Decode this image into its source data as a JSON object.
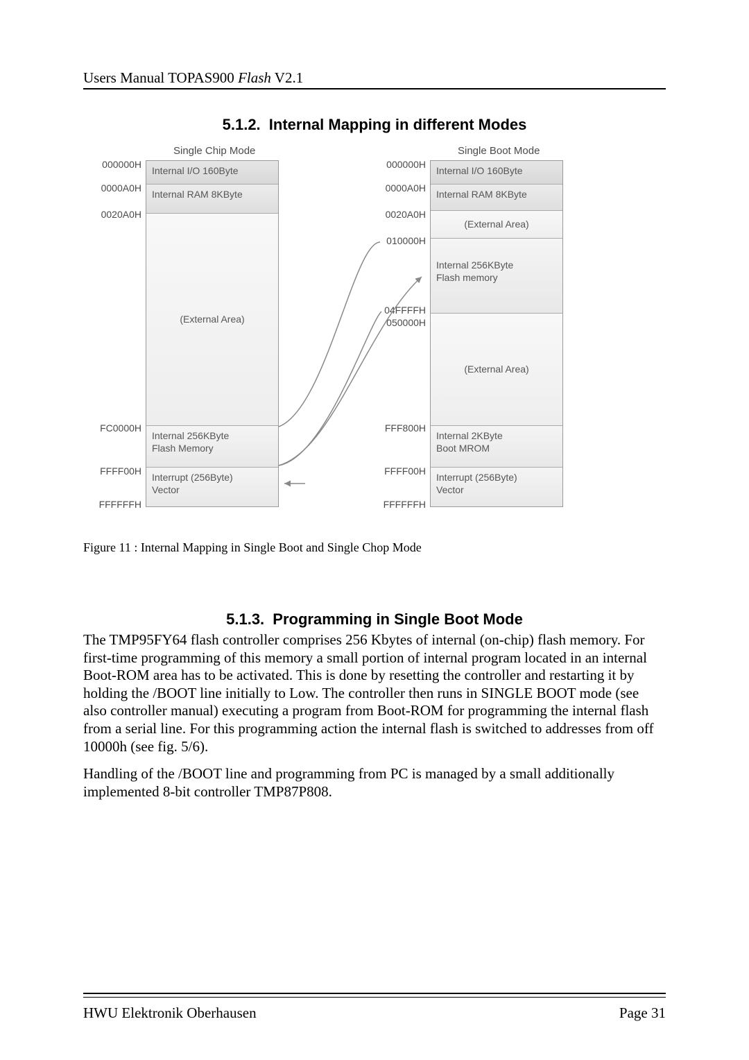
{
  "header": {
    "prefix": "Users Manual TOPAS900 ",
    "italic": "Flash",
    "suffix": " V2.1"
  },
  "section_a": {
    "num": "5.1.2.",
    "title": "Internal Mapping in different Modes"
  },
  "diagram": {
    "left_title": "Single Chip Mode",
    "right_title": "Single Boot Mode",
    "left_addrs": [
      "000000H",
      "0000A0H",
      "0020A0H",
      "FC0000H",
      "FFFF00H",
      "FFFFFFH"
    ],
    "right_addrs": [
      "000000H",
      "0000A0H",
      "0020A0H",
      "010000H",
      "04FFFFH",
      "050000H",
      "FFF800H",
      "FFFF00H",
      "FFFFFFH"
    ],
    "left_blocks": [
      "Internal I/O   160Byte",
      "Internal RAM 8KByte",
      "(External Area)",
      "Internal   256KByte\nFlash Memory",
      "Interrupt   (256Byte)\nVector"
    ],
    "right_blocks": [
      "Internal I/O   160Byte",
      "Internal RAM 8KByte",
      "(External Area)",
      "Internal   256KByte\nFlash memory",
      "(External Area)",
      "Internal   2KByte\nBoot MROM",
      "Interrupt   (256Byte)\nVector"
    ]
  },
  "figure_caption": "Figure 11 : Internal Mapping in Single Boot and Single Chop Mode",
  "section_b": {
    "num": "5.1.3.",
    "title": "Programming in Single Boot Mode"
  },
  "para1": "The TMP95FY64 flash controller comprises 256 Kbytes of internal (on-chip) flash memory. For first-time programming of this memory a small portion of internal program located in an internal Boot-ROM area has to be activated. This is done by resetting the controller and restarting it by holding the /BOOT line initially to Low. The controller then runs in SINGLE BOOT mode (see also controller manual) executing a program from Boot-ROM for programming the internal flash from a serial line. For this programming action the internal flash is switched to addresses from off 10000h (see fig. 5/6).",
  "para2": "Handling of the /BOOT line and programming from PC is managed by a small additionally implemented 8-bit controller TMP87P808.",
  "footer": {
    "left": "HWU Elektronik Oberhausen",
    "right": "Page 31"
  }
}
